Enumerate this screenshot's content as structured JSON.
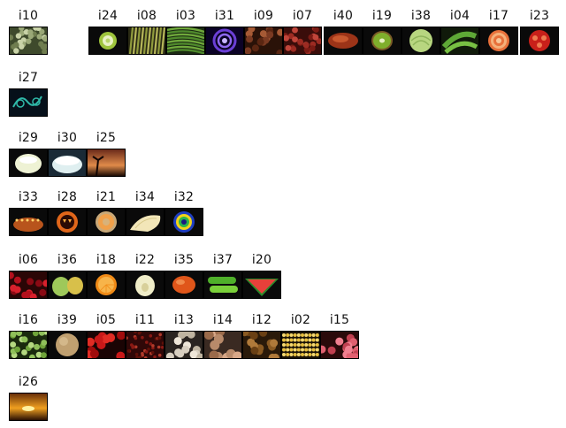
{
  "rows": [
    {
      "items": [
        {
          "label": "i10",
          "icon": "broccoli-icon"
        },
        {
          "label": "i24",
          "icon": "pepper-slice-icon"
        },
        {
          "label": "i08",
          "icon": "asparagus-icon"
        },
        {
          "label": "i03",
          "icon": "green-beans-icon"
        },
        {
          "label": "i31",
          "icon": "purple-spiral-icon"
        },
        {
          "label": "i09",
          "icon": "nuts-icon"
        },
        {
          "label": "i07",
          "icon": "red-beans-icon"
        },
        {
          "label": "i40",
          "icon": "dried-fruit-icon"
        },
        {
          "label": "i19",
          "icon": "kiwi-icon"
        },
        {
          "label": "i38",
          "icon": "cabbage-icon"
        },
        {
          "label": "i04",
          "icon": "pea-pods-icon"
        },
        {
          "label": "i17",
          "icon": "onion-slice-icon"
        },
        {
          "label": "i23",
          "icon": "tomato-slice-icon"
        }
      ]
    },
    {
      "items": [
        {
          "label": "i27",
          "icon": "teal-swirl-icon"
        }
      ]
    },
    {
      "items": [
        {
          "label": "i29",
          "icon": "white-onion-icon"
        },
        {
          "label": "i30",
          "icon": "yogurt-bowl-icon"
        },
        {
          "label": "i25",
          "icon": "sunset-palm-icon"
        }
      ]
    },
    {
      "items": [
        {
          "label": "i33",
          "icon": "candle-bread-icon"
        },
        {
          "label": "i28",
          "icon": "pumpkin-lantern-icon"
        },
        {
          "label": "i21",
          "icon": "melon-slice-icon"
        },
        {
          "label": "i34",
          "icon": "pear-slice-icon"
        },
        {
          "label": "i32",
          "icon": "blue-yellow-ring-icon"
        }
      ]
    },
    {
      "items": [
        {
          "label": "i06",
          "icon": "cherries-icon"
        },
        {
          "label": "i36",
          "icon": "pear-icon"
        },
        {
          "label": "i18",
          "icon": "orange-slice-icon"
        },
        {
          "label": "i22",
          "icon": "pear-half-icon"
        },
        {
          "label": "i35",
          "icon": "papaya-icon"
        },
        {
          "label": "i37",
          "icon": "green-peppers-icon"
        },
        {
          "label": "i20",
          "icon": "watermelon-slice-icon"
        }
      ]
    },
    {
      "items": [
        {
          "label": "i16",
          "icon": "peas-icon"
        },
        {
          "label": "i39",
          "icon": "melon-icon"
        },
        {
          "label": "i05",
          "icon": "red-peppers-icon"
        },
        {
          "label": "i11",
          "icon": "red-grains-icon"
        },
        {
          "label": "i13",
          "icon": "garlic-icon"
        },
        {
          "label": "i14",
          "icon": "potatoes-icon"
        },
        {
          "label": "i12",
          "icon": "brown-fruits-icon"
        },
        {
          "label": "i02",
          "icon": "corn-icon"
        },
        {
          "label": "i15",
          "icon": "pink-fruit-pile-icon"
        }
      ]
    },
    {
      "items": [
        {
          "label": "i26",
          "icon": "golden-sunset-icon"
        }
      ]
    }
  ]
}
